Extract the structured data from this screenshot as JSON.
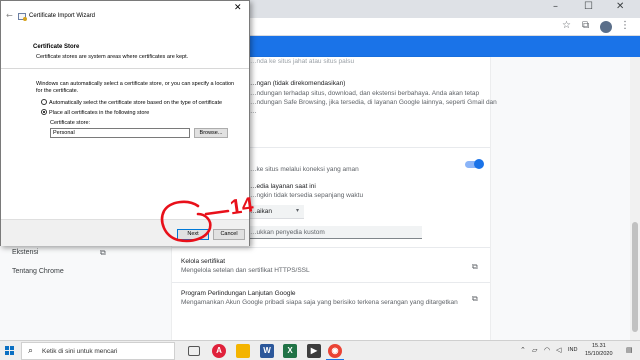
{
  "wizard": {
    "title": "Certificate Import Wizard",
    "heading": "Certificate Store",
    "subheading": "Certificate stores are system areas where certificates are kept.",
    "description": "Windows can automatically select a certificate store, or you can specify a location for the certificate.",
    "radio_auto_label": "Automatically select the certificate store based on the type of certificate",
    "radio_manual_label": "Place all certificates in the following store",
    "selected_option": "manual",
    "store_label": "Certificate store:",
    "store_value": "Personal",
    "browse_label": "Browse...",
    "next_label": "Next",
    "cancel_label": "Cancel"
  },
  "annotation": {
    "number": "14",
    "color": "#e8101a"
  },
  "settings": {
    "header_color": "#1a73e8",
    "top_partial": "…nda ke situs jahat atau situs palsu",
    "safe_browsing_title": "…ngan (tidak direkomendasikan)",
    "safe_browsing_desc_1": "…ndungan terhadap situs, download, dan ekstensi berbahaya. Anda akan tetap",
    "safe_browsing_desc_2": "…ndungan Safe Browsing, jika tersedia, di layanan Google lainnya, seperti Gmail dan",
    "safe_browsing_desc_3": "…",
    "secure_dns_desc": "…ke situs melalui koneksi yang aman",
    "dns_provider_title": "…edia layanan saat ini",
    "dns_provider_desc": "…ngkin tidak tersedia sepanjang waktu",
    "dns_select_value": "…aikan",
    "dns_input_placeholder": "…ukkan penyedia kustom",
    "manage_certs_title": "Kelola sertifikat",
    "manage_certs_desc": "Mengelola setelan dan sertifikat HTTPS/SSL",
    "advanced_protection_title": "Program Perlindungan Lanjutan Google",
    "advanced_protection_desc": "Mengamankan Akun Google pribadi siapa saja yang berisiko terkena serangan yang ditargetkan",
    "secure_dns_enabled": true
  },
  "sidebar": {
    "extensions_label": "Ekstensi",
    "about_label": "Tentang Chrome"
  },
  "taskbar": {
    "search_placeholder": "Ketik di sini untuk mencari",
    "language": "IND",
    "time": "15.31",
    "date": "15/10/2020",
    "apps": [
      "task-view",
      "opera",
      "file-explorer",
      "word",
      "excel",
      "media-player",
      "chrome"
    ]
  }
}
